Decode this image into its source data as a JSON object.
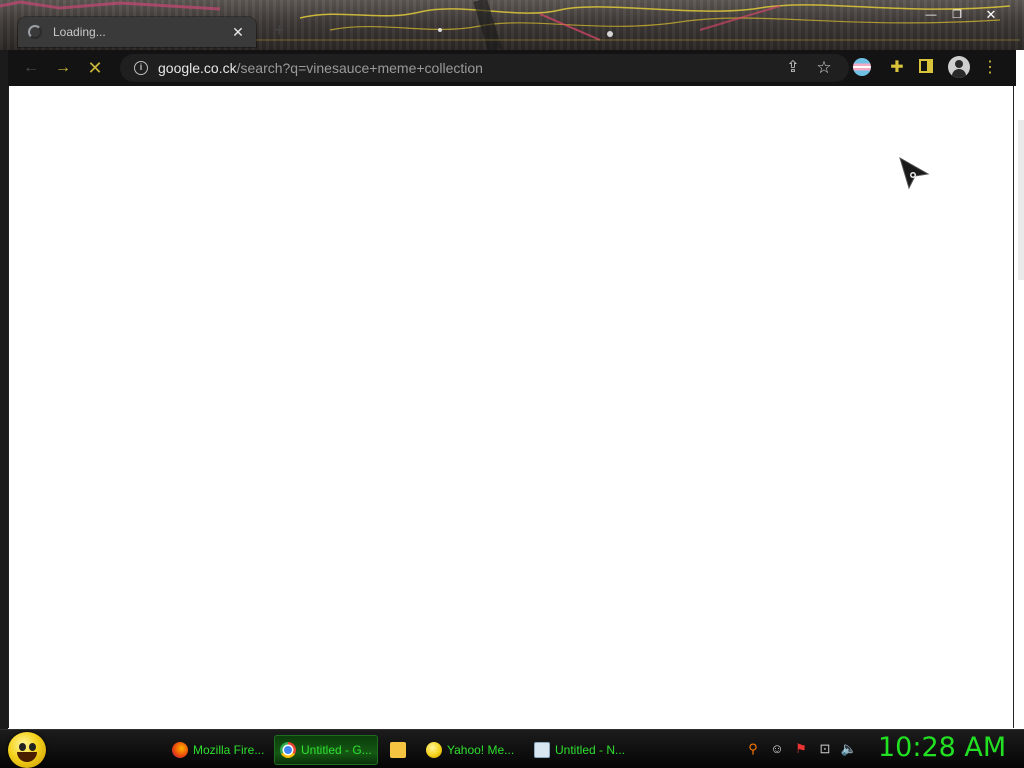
{
  "browser": {
    "tab": {
      "title": "Loading...",
      "close_glyph": "✕",
      "loading_icon": "spinner-icon"
    },
    "window_controls": {
      "minimize": "—",
      "maximize": "❐",
      "close": "✕"
    },
    "toolbar": {
      "back_glyph": "←",
      "forward_glyph": "→",
      "stop_glyph": "✕",
      "url_host": "google.co.ck",
      "url_path": "/search?q=vinesauce+meme+collection",
      "info_glyph": "i",
      "share_glyph": "⇪",
      "star_glyph": "☆",
      "extensions_glyph": "✚",
      "menu_glyph": "⋮"
    },
    "accent_color": "#c8b53a"
  },
  "taskbar": {
    "tasks": [
      {
        "label": "Mozilla Fire...",
        "icon": "firefox-icon"
      },
      {
        "label": "Untitled - G...",
        "icon": "chrome-icon"
      },
      {
        "label": "",
        "icon": "folder-icon"
      },
      {
        "label": "Yahoo! Me...",
        "icon": "yahoo-messenger-icon"
      },
      {
        "label": "Untitled - N...",
        "icon": "notepad-icon"
      }
    ],
    "tray": {
      "search_glyph": "⚲",
      "messenger_glyph": "☺",
      "flag_glyph": "⚑",
      "network_glyph": "⊡",
      "volume_glyph": "🔈"
    },
    "clock": "10:28 AM",
    "clock_color": "#22e022"
  }
}
